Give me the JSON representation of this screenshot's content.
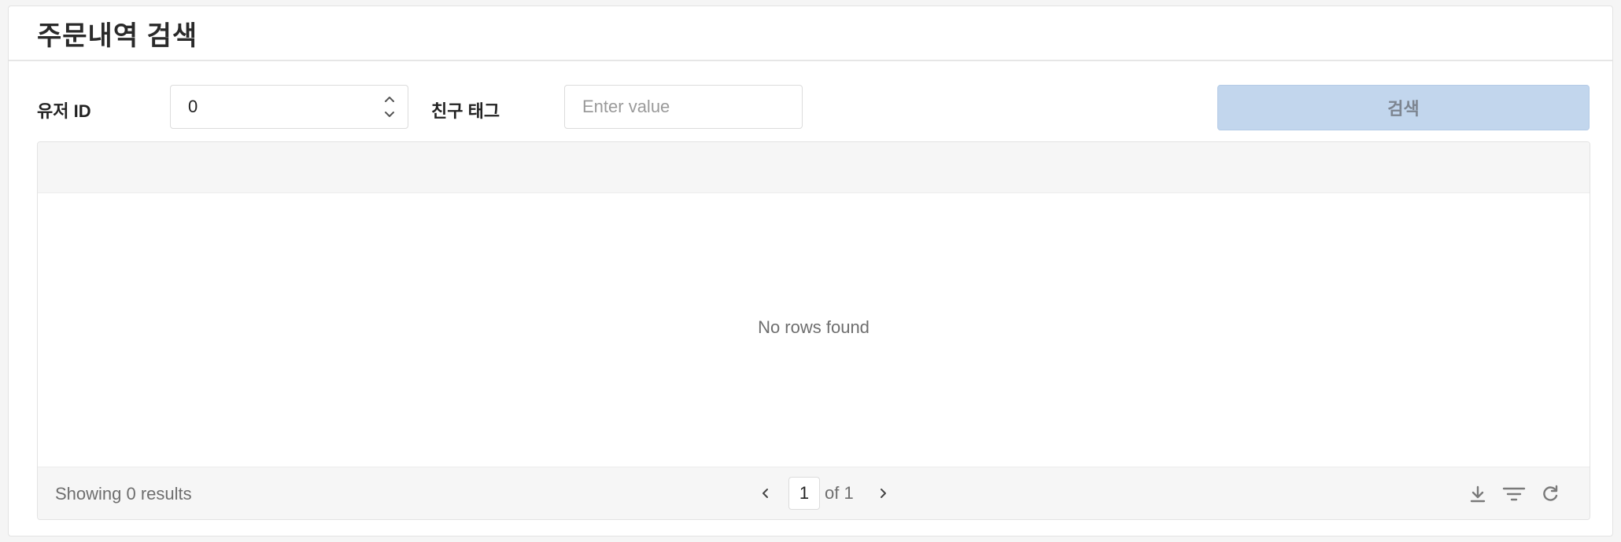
{
  "page": {
    "title": "주문내역 검색"
  },
  "form": {
    "user_id_label": "유저 ID",
    "user_id_value": "0",
    "friend_tag_label": "친구 태그",
    "friend_tag_placeholder": "Enter value",
    "search_button": "검색"
  },
  "grid": {
    "empty_message": "No rows found",
    "footer": {
      "showing": "Showing 0 results",
      "current_page": "1",
      "of_pages": "of 1"
    },
    "tools": [
      "download-icon",
      "filter-icon",
      "refresh-icon"
    ]
  },
  "colors": {
    "search_button_bg": "#c2d6ed",
    "grid_header_bg": "#f6f6f6"
  }
}
